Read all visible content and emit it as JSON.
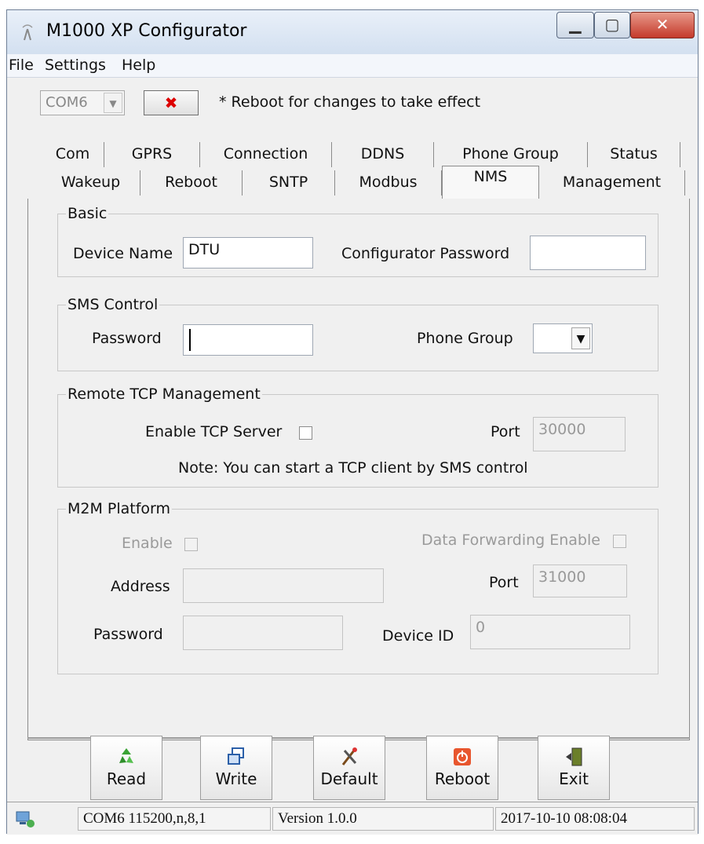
{
  "window": {
    "title": "M1000 XP Configurator"
  },
  "menu": [
    "File",
    "Settings",
    "Help"
  ],
  "toolbar": {
    "com_port": "COM6",
    "note": "* Reboot for changes to take effect"
  },
  "tabs_row1": [
    "Com",
    "GPRS",
    "Connection",
    "DDNS",
    "Phone Group",
    "Status"
  ],
  "tabs_row2": [
    "Wakeup",
    "Reboot",
    "SNTP",
    "Modbus",
    "NMS",
    "Management"
  ],
  "basic": {
    "legend": "Basic",
    "device_name_label": "Device Name",
    "device_name_value": "DTU",
    "configurator_password_label": "Configurator Password",
    "configurator_password_value": ""
  },
  "sms_control": {
    "legend": "SMS Control",
    "password_label": "Password",
    "password_value": "",
    "phone_group_label": "Phone Group",
    "phone_group_value": ""
  },
  "remote_tcp": {
    "legend": "Remote TCP Management",
    "enable_label": "Enable TCP Server",
    "enable_checked": false,
    "port_label": "Port",
    "port_value": "30000",
    "note": "Note: You can start a TCP client by SMS control"
  },
  "m2m": {
    "legend": "M2M Platform",
    "enable_label": "Enable",
    "data_forwarding_label": "Data Forwarding Enable",
    "address_label": "Address",
    "address_value": "",
    "port_label": "Port",
    "port_value": "31000",
    "password_label": "Password",
    "password_value": "",
    "device_id_label": "Device ID",
    "device_id_value": "0"
  },
  "buttons": {
    "read": "Read",
    "write": "Write",
    "default": "Default",
    "reboot": "Reboot",
    "exit": "Exit"
  },
  "status": {
    "connection": "COM6 115200,n,8,1",
    "version": "Version 1.0.0",
    "datetime": "2017-10-10 08:08:04"
  },
  "colors": {
    "title_bar": "#d3e0f0",
    "close_button": "#c4392a",
    "panel": "#f0f0f0"
  }
}
